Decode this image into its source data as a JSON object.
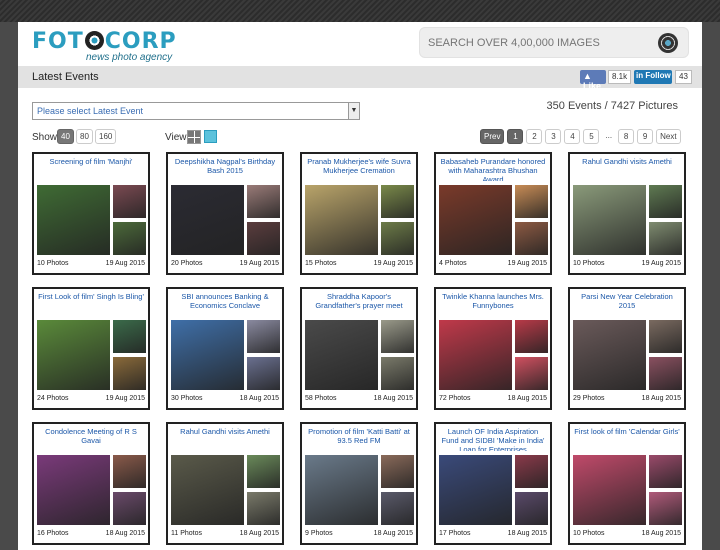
{
  "header": {
    "logo_text_a": "FOT",
    "logo_text_b": "CORP",
    "logo_tagline": "news photo agency",
    "search_placeholder": "SEARCH OVER 4,00,000 IMAGES"
  },
  "events_bar": {
    "title": "Latest Events",
    "fb_like_label": "Like",
    "fb_like_count": "8.1k",
    "li_follow_label": "Follow",
    "li_follow_count": "43"
  },
  "controls": {
    "event_select_placeholder": "Please select Latest Event",
    "counts_text": "350 Events / 7427 Pictures",
    "show_label": "Show",
    "show_options": [
      "40",
      "80",
      "160"
    ],
    "view_label": "View",
    "pager": [
      "Prev",
      "1",
      "2",
      "3",
      "4",
      "5",
      "...",
      "8",
      "9",
      "Next"
    ]
  },
  "events": [
    {
      "title": "Screening of film 'Manjhi'",
      "count": "10 Photos",
      "date": "19 Aug 2015",
      "colors": [
        "#3f6b34",
        "#7b4a52",
        "#4c6a3a"
      ]
    },
    {
      "title": "Deepshikha Nagpal's Birthday Bash 2015",
      "count": "20 Photos",
      "date": "19 Aug 2015",
      "colors": [
        "#2b2b33",
        "#9a7b78",
        "#5b3d3e"
      ]
    },
    {
      "title": "Pranab Mukherjee's wife Suvra Mukherjee Cremation",
      "count": "15 Photos",
      "date": "19 Aug 2015",
      "colors": [
        "#b9a46a",
        "#7a8a4a",
        "#6d7c48"
      ]
    },
    {
      "title": "Babasaheb Purandare honored with Maharashtra Bhushan Award",
      "count": "4 Photos",
      "date": "19 Aug 2015",
      "colors": [
        "#7a3a2a",
        "#c88c56",
        "#8d5a43"
      ]
    },
    {
      "title": "Rahul Gandhi visits Amethi",
      "count": "10 Photos",
      "date": "19 Aug 2015",
      "colors": [
        "#8a9a7a",
        "#5f7a52",
        "#7f8c70"
      ]
    },
    {
      "title": "First Look of film' Singh Is Bling'",
      "count": "24 Photos",
      "date": "19 Aug 2015",
      "colors": [
        "#5a8a3a",
        "#3b6b4a",
        "#8a6a3a"
      ]
    },
    {
      "title": "SBI announces Banking & Economics Conclave",
      "count": "30 Photos",
      "date": "18 Aug 2015",
      "colors": [
        "#3f6fa8",
        "#8a8aa0",
        "#6a7090"
      ]
    },
    {
      "title": "Shraddha Kapoor's Grandfather's prayer meet",
      "count": "58 Photos",
      "date": "18 Aug 2015",
      "colors": [
        "#4a4a4a",
        "#9a9a8a",
        "#7a7a6a"
      ]
    },
    {
      "title": "Twinkle Khanna launches Mrs. Funnybones",
      "count": "72 Photos",
      "date": "18 Aug 2015",
      "colors": [
        "#c0394a",
        "#b83a48",
        "#d05060"
      ]
    },
    {
      "title": "Parsi New Year Celebration 2015",
      "count": "29 Photos",
      "date": "18 Aug 2015",
      "colors": [
        "#6a5a5a",
        "#7a6a60",
        "#8a5060"
      ]
    },
    {
      "title": "Condolence Meeting of R S Gavai",
      "count": "16 Photos",
      "date": "18 Aug 2015",
      "colors": [
        "#7a3a7a",
        "#8a5a4a",
        "#6a4a6a"
      ]
    },
    {
      "title": "Rahul Gandhi visits Amethi",
      "count": "11 Photos",
      "date": "18 Aug 2015",
      "colors": [
        "#5a5a4a",
        "#6a8a5a",
        "#7a7a6a"
      ]
    },
    {
      "title": "Promotion of film 'Katti Batti' at 93.5 Red FM",
      "count": "9 Photos",
      "date": "18 Aug 2015",
      "colors": [
        "#6a7a8a",
        "#8a6a5a",
        "#5a5a6a"
      ]
    },
    {
      "title": "Launch OF India Aspiration Fund and SIDBI 'Make in India' Loan for Enterprises",
      "count": "17 Photos",
      "date": "18 Aug 2015",
      "colors": [
        "#3a4a7a",
        "#8a3a4a",
        "#5a4a6a"
      ]
    },
    {
      "title": "First look of film 'Calendar Girls'",
      "count": "10 Photos",
      "date": "18 Aug 2015",
      "colors": [
        "#c04a6a",
        "#9a4a6a",
        "#b05a7a"
      ]
    }
  ]
}
